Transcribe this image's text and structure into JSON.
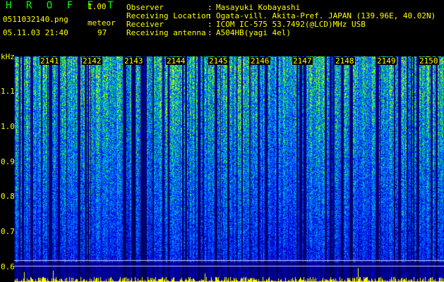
{
  "header": {
    "brand": "H R O F F T",
    "version": "1.00",
    "filename": "0511032140.png",
    "datetime": "05.11.03 21:40",
    "meteor_label": "meteor",
    "meteor_count": "97"
  },
  "info": [
    {
      "label": "Observer",
      "sep": ":",
      "value": "Masayuki Kobayashi"
    },
    {
      "label": "Receiving Location",
      "sep": ":",
      "value": "Ogata-vill. Akita-Pref. JAPAN (139.96E, 40.02N)"
    },
    {
      "label": "Receiver",
      "sep": ":",
      "value": "ICOM IC-575 53.7492(@LCD)MHz USB"
    },
    {
      "label": "Receiving antenna",
      "sep": ":",
      "value": "A504HB(yagi 4el)"
    }
  ],
  "spectrogram": {
    "y_unit": "kHz",
    "y_ticks": [
      "1.1",
      "1.0",
      "0.9",
      "0.8",
      "0.7",
      "0.6"
    ],
    "x_ticks": [
      "2141",
      "2142",
      "2143",
      "2144",
      "2145",
      "2146",
      "2147",
      "2148",
      "2149",
      "2150"
    ],
    "colors": {
      "low": "#000060",
      "mid": "#0060ff",
      "high": "#00ff80",
      "peak": "#ffff00",
      "text": "#ffff00"
    }
  }
}
